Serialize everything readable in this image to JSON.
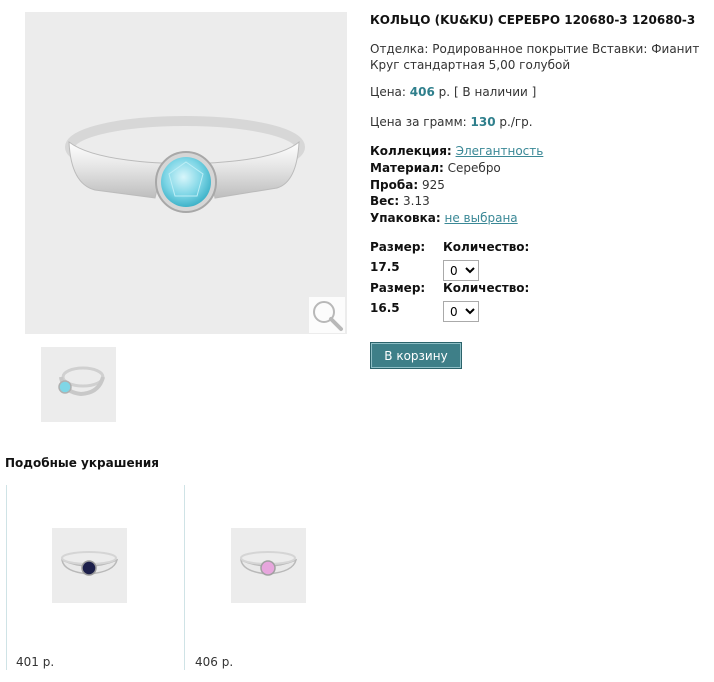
{
  "product": {
    "title": "КОЛЬЦО (KU&KU) СЕРЕБРО 120680-3 120680-3",
    "description": "Отделка: Родированное покрытие Вставки: Фианит Круг стандартная 5,00 голубой",
    "price_label": "Цена:",
    "price_value": "406",
    "price_unit": "р.",
    "availability": "[ В наличии ]",
    "price_per_gram_label": "Цена за грамм:",
    "price_per_gram_value": "130",
    "price_per_gram_unit": "р./гр.",
    "collection_label": "Коллекция:",
    "collection_value": "Элегантность",
    "material_label": "Материал:",
    "material_value": "Серебро",
    "probe_label": "Проба:",
    "probe_value": "925",
    "weight_label": "Вес:",
    "weight_value": "3.13",
    "packaging_label": "Упаковка:",
    "packaging_value": "не выбрана"
  },
  "sizes": [
    {
      "size_label": "Размер:",
      "size_value": "17.5",
      "qty_label": "Количество:",
      "qty_value": "0"
    },
    {
      "size_label": "Размер:",
      "size_value": "16.5",
      "qty_label": "Количество:",
      "qty_value": "0"
    }
  ],
  "cart_button": "В корзину",
  "similar": {
    "title": "Подобные украшения",
    "items": [
      {
        "price": "401 р.",
        "stone_color": "#1c1f4a"
      },
      {
        "price": "406 р.",
        "stone_color": "#e7a6dd"
      }
    ]
  },
  "colors": {
    "accent": "#3a8896",
    "button": "#3e7f88",
    "main_stone": "#7fd6e6"
  }
}
